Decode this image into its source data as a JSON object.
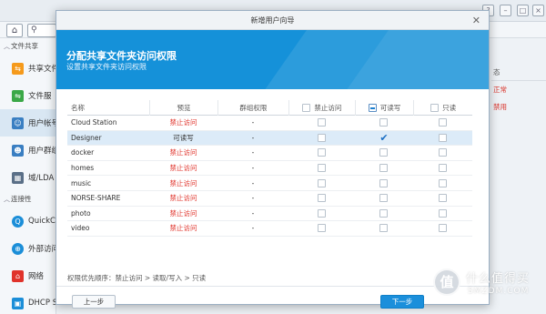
{
  "background": {
    "sidebar": {
      "sections": [
        {
          "label": "文件共享"
        },
        {
          "label": "连接性"
        }
      ],
      "items": [
        {
          "label": "共享文件",
          "icon": "share-folder-icon",
          "color": "#f59a1b"
        },
        {
          "label": "文件服",
          "icon": "file-service-icon",
          "color": "#3aa847"
        },
        {
          "label": "用户帐号",
          "icon": "user-icon",
          "color": "#3a7fc2"
        },
        {
          "label": "用户群组",
          "icon": "user-group-icon",
          "color": "#3a7fc2"
        },
        {
          "label": "域/LDA",
          "icon": "domain-icon",
          "color": "#5a6f87"
        },
        {
          "label": "QuickC",
          "icon": "quickconnect-icon",
          "color": "#1b8ed8"
        },
        {
          "label": "外部访问",
          "icon": "external-access-icon",
          "color": "#1b8ed8"
        },
        {
          "label": "网络",
          "icon": "network-icon",
          "color": "#e0332b"
        },
        {
          "label": "DHCP Server",
          "icon": "dhcp-icon",
          "color": "#1b8ed8"
        }
      ]
    },
    "right_column": [
      "态",
      "正常",
      "禁用"
    ]
  },
  "dialog": {
    "title": "新增用户向导",
    "header_title": "分配共享文件夹访问权限",
    "header_subtitle": "设置共享文件夹访问权限",
    "columns": {
      "name": "名称",
      "preview": "预览",
      "group_perm": "群组权限",
      "deny": "禁止访问",
      "read_write": "可读写",
      "read_only": "只读"
    },
    "rows": [
      {
        "name": "Cloud Station",
        "preview": "禁止访问",
        "group": "-",
        "rw": false
      },
      {
        "name": "Designer",
        "preview": "可读写",
        "group": "-",
        "rw": true
      },
      {
        "name": "docker",
        "preview": "禁止访问",
        "group": "-",
        "rw": false
      },
      {
        "name": "homes",
        "preview": "禁止访问",
        "group": "-",
        "rw": false
      },
      {
        "name": "music",
        "preview": "禁止访问",
        "group": "-",
        "rw": false
      },
      {
        "name": "NORSE-SHARE",
        "preview": "禁止访问",
        "group": "-",
        "rw": false
      },
      {
        "name": "photo",
        "preview": "禁止访问",
        "group": "-",
        "rw": false
      },
      {
        "name": "video",
        "preview": "禁止访问",
        "group": "-",
        "rw": false
      }
    ],
    "priority_note": "权限优先顺序：禁止访问 > 读取/写入 > 只读",
    "prev_label": "上一步",
    "next_label": "下一步"
  },
  "watermark": {
    "logo_char": "值",
    "text": "什么值得买",
    "url": "SMZDM.COM"
  },
  "colors": {
    "accent": "#1591d9",
    "deny_red": "#e0332b"
  }
}
